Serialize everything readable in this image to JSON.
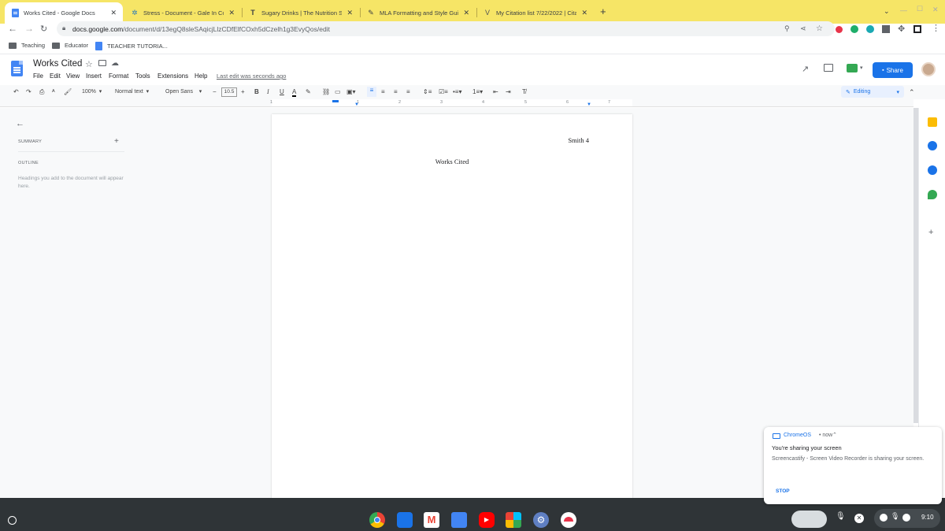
{
  "browser": {
    "tabs": [
      {
        "title": "Works Cited - Google Docs",
        "icon": "docs-icon",
        "active": true
      },
      {
        "title": "Stress - Document - Gale In Cont",
        "icon": "gale-icon",
        "active": false
      },
      {
        "title": "Sugary Drinks | The Nutrition So",
        "icon": "harvard-icon",
        "active": false
      },
      {
        "title": "MLA Formatting and Style Guide",
        "icon": "owl-icon",
        "active": false
      },
      {
        "title": "My Citation list 7/22/2022 | Cita",
        "icon": "citation-icon",
        "active": false
      }
    ],
    "new_tab": "+",
    "url_host": "docs.google.com",
    "url_path": "/document/d/13egQ8sleSAqicjLlzCDfElfCOxh5dCzelh1g3EvyQos/edit",
    "bookmarks": [
      "Teaching",
      "Educator",
      "TEACHER TUTORIA..."
    ]
  },
  "docs": {
    "title": "Works Cited",
    "menus": [
      "File",
      "Edit",
      "View",
      "Insert",
      "Format",
      "Tools",
      "Extensions",
      "Help"
    ],
    "last_edit": "Last edit was seconds ago",
    "share_label": "Share",
    "toolbar": {
      "zoom": "100%",
      "style": "Normal text",
      "font": "Open Sans",
      "font_size": "10.5",
      "mode": "Editing"
    },
    "ruler_labels": [
      "1",
      "1",
      "2",
      "3",
      "4",
      "5",
      "6",
      "7"
    ],
    "outline": {
      "summary_label": "SUMMARY",
      "outline_label": "OUTLINE",
      "placeholder": "Headings you add to the document will appear here."
    },
    "page": {
      "header": "Smith 4",
      "heading": "Works Cited"
    }
  },
  "notification": {
    "source": "ChromeOS",
    "time": "• now",
    "title": "You're sharing your screen",
    "body": "Screencastify - Screen Video Recorder is sharing your screen.",
    "action": "STOP"
  },
  "shelf": {
    "apps": [
      "chrome-icon",
      "files-icon",
      "gmail-icon",
      "docs-icon",
      "youtube-icon",
      "play-store-icon",
      "settings-icon",
      "screencastify-icon"
    ],
    "time": "9:10"
  },
  "colors": {
    "tabstrip": "#f6e566",
    "accent": "#1a73e8",
    "shelf": "#2f3437"
  }
}
